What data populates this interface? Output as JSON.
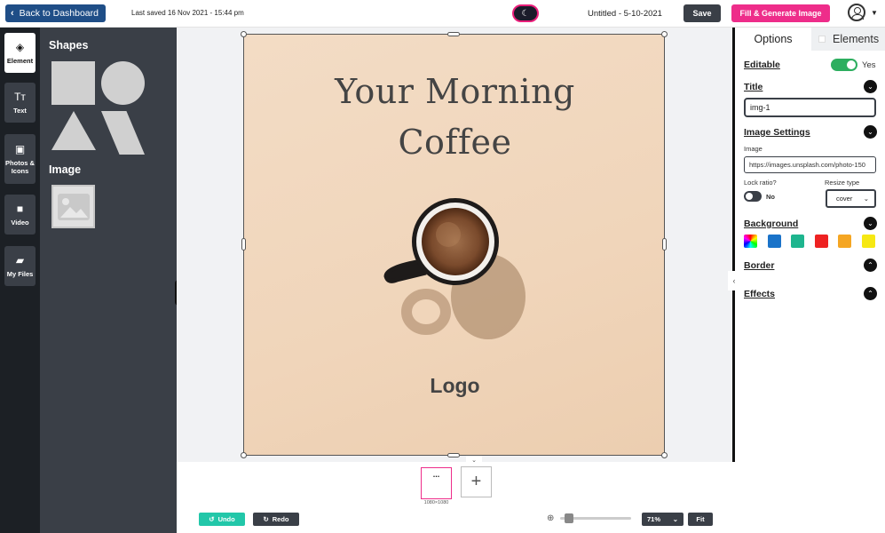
{
  "topbar": {
    "back_label": "Back to Dashboard",
    "last_saved": "Last saved 16 Nov 2021 - 15:44 pm",
    "doc_title": "Untitled - 5-10-2021",
    "save_label": "Save",
    "fill_label": "Fill & Generate Image"
  },
  "rail": {
    "items": [
      {
        "label": "Element",
        "icon": "layers-icon"
      },
      {
        "label": "Text",
        "icon": "text-icon"
      },
      {
        "label": "Photos & Icons",
        "icon": "photos-icon"
      },
      {
        "label": "Video",
        "icon": "video-icon"
      },
      {
        "label": "My Files",
        "icon": "folder-icon"
      }
    ]
  },
  "panel": {
    "shapes_heading": "Shapes",
    "image_heading": "Image"
  },
  "artboard": {
    "title_line1": "Your Morning",
    "title_line2": "Coffee",
    "logo": "Logo"
  },
  "pages": {
    "thumb_label": "...",
    "size_label": "1080×1080",
    "add_label": "+"
  },
  "bottom": {
    "undo_label": "Undo",
    "redo_label": "Redo",
    "zoom_value": "71%",
    "fit_label": "Fit"
  },
  "right_panel": {
    "tabs": [
      "Options",
      "Elements"
    ],
    "editable_label": "Editable",
    "editable_value": "Yes",
    "title_label": "Title",
    "title_value": "img-1",
    "image_settings_label": "Image Settings",
    "image_label": "Image",
    "image_url": "https://images.unsplash.com/photo-150",
    "lock_ratio_label": "Lock ratio?",
    "lock_ratio_value": "No",
    "resize_type_label": "Resize type",
    "resize_type_value": "cover",
    "background_label": "Background",
    "border_label": "Border",
    "effects_label": "Effects",
    "background_swatches": [
      "#1a73c9",
      "#1eb58e",
      "#ee2222",
      "#f5a623",
      "#f6e813"
    ]
  },
  "colors": {
    "accent_pink": "#ee2d8a",
    "navy": "#1f4e87",
    "teal": "#22c7a9",
    "dark": "#3a3f47"
  }
}
